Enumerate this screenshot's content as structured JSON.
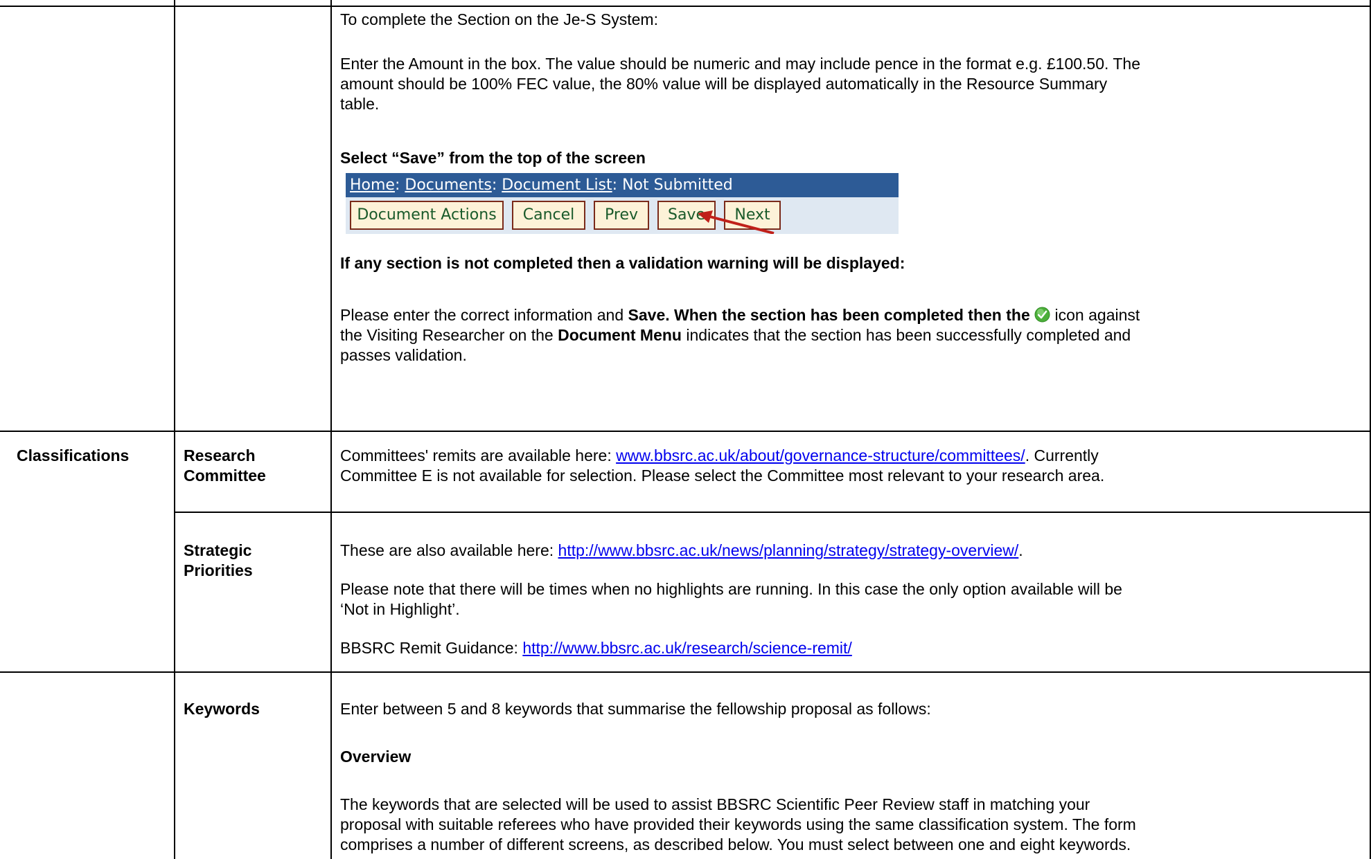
{
  "top_section": {
    "intro": "To complete the Section on the Je-S System:",
    "amount_text": [
      "Enter the Amount in the box. The value should be numeric and may include pence in the format e.g. £100.50. The",
      "amount should be 100% FEC value, the 80% value will be displayed automatically in the Resource Summary",
      "table."
    ],
    "save_heading": "Select “Save” from the top of the screen",
    "breadcrumb": {
      "home": "Home",
      "documents": "Documents",
      "document_list": "Document List",
      "status": "Not Submitted"
    },
    "buttons": {
      "document_actions": "Document Actions",
      "cancel": "Cancel",
      "prev": "Prev",
      "save": "Save",
      "next": "Next"
    },
    "validation_heading": "If any section is not completed then a validation warning will be displayed:",
    "enter_info_line1": {
      "a": "Please enter the correct information and ",
      "b": "Save. When the section has been completed then the ",
      "c": " icon against"
    },
    "enter_info_line2": {
      "a": "the Visiting Researcher on the ",
      "b": "Document Menu",
      "c": " indicates that the section has been successfully completed and"
    },
    "enter_info_line3": "passes validation."
  },
  "classifications": {
    "label": "Classifications",
    "research_committee": {
      "label_1": "Research",
      "label_2": "Committee",
      "line1_a": "Committees' remits are available here: ",
      "line1_link": "www.bbsrc.ac.uk/about/governance-structure/committees/",
      "line1_b": ".  Currently",
      "line2": "Committee E is not available for selection.  Please select the Committee most relevant to your research area."
    },
    "strategic_priorities": {
      "label_1": "Strategic",
      "label_2": "Priorities",
      "line1_a": "These are also available here: ",
      "line1_link": "http://www.bbsrc.ac.uk/news/planning/strategy/strategy-overview/",
      "line1_b": ".",
      "note_1": "Please note that there will be times when no highlights are running.  In this case the only option available will be",
      "note_2": "‘Not in Highlight’.",
      "remit_label": "BBSRC Remit Guidance: ",
      "remit_link": "http://www.bbsrc.ac.uk/research/science-remit/"
    }
  },
  "keywords": {
    "label": "Keywords",
    "intro": "Enter between 5 and 8 keywords that summarise the fellowship proposal as follows:",
    "overview_heading": "Overview",
    "overview_1": "The keywords that are selected will be used to assist BBSRC Scientific Peer Review staff in matching your",
    "overview_2": "proposal with suitable referees who have provided their keywords using the same classification system. The form",
    "overview_3": "comprises a number of different screens, as described below. You must select between one and eight keywords."
  },
  "colors": {
    "link": "#0000ee",
    "breadcrumb_bar": "#2d5b96",
    "button_border": "#7a2a1a",
    "button_text": "#1a5a2a",
    "check_icon": "#4caf3a",
    "arrow": "#c0201a"
  },
  "icons": [
    "check-icon",
    "arrow-pointer-icon"
  ]
}
